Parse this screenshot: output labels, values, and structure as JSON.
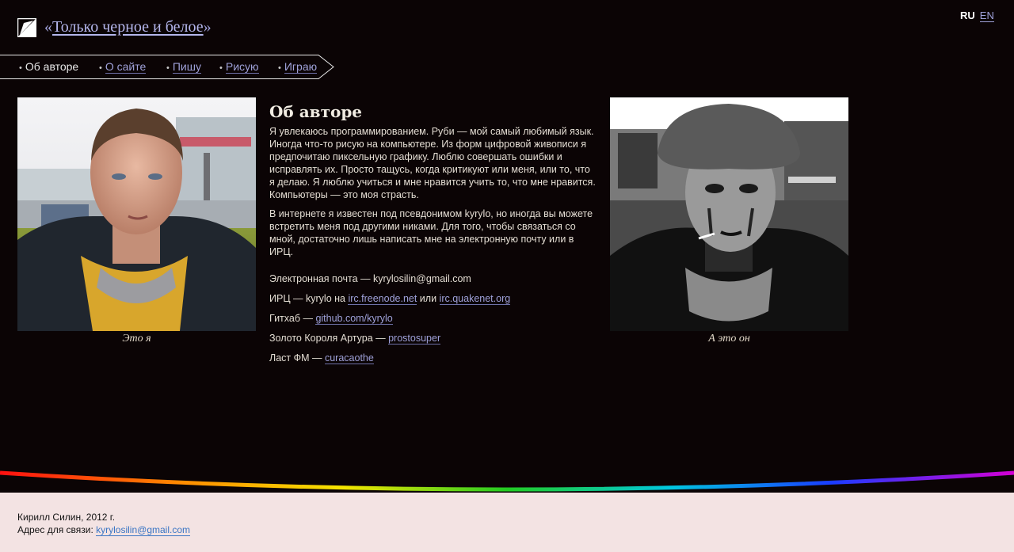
{
  "header": {
    "logo_icon": "black-white-square-logo",
    "quote_open": "«",
    "title": "Только черное и белое",
    "quote_close": "»"
  },
  "lang": {
    "current": "RU",
    "other": "EN"
  },
  "nav": {
    "items": [
      {
        "label": "Об авторе",
        "active": true
      },
      {
        "label": "О сайте",
        "active": false
      },
      {
        "label": "Пишу",
        "active": false
      },
      {
        "label": "Рисую",
        "active": false
      },
      {
        "label": "Играю",
        "active": false
      }
    ]
  },
  "photos": {
    "left_caption": "Это я",
    "right_caption": "А это он"
  },
  "content": {
    "heading": "Об авторе",
    "para1": "Я увлекаюсь программированием. Руби — мой самый любимый язык. Иногда что-то рисую на компьютере. Из форм цифровой живописи я предпочитаю пиксельную графику. Люблю совершать ошибки и исправлять их. Просто тащусь, когда критикуют или меня, или то, что я делаю. Я люблю учиться и мне нравится учить то, что мне нравится. Компьютеры — это моя страсть.",
    "para2": "В интернете я известен под псевдонимом kyrylo, но иногда вы можете встретить меня под другими никами. Для того, чтобы связаться со мной, достаточно лишь написать мне на электронную почту или в ИРЦ.",
    "email_text": "Электронная почта — kyrylosilin@gmail.com",
    "irc_prefix": "ИРЦ — kyrylo на ",
    "irc_link1": "irc.freenode.net",
    "irc_or": " или ",
    "irc_link2": "irc.quakenet.org",
    "github_prefix": "Гитхаб — ",
    "github_link": "github.com/kyrylo",
    "gold_prefix": "Золото Короля Артура — ",
    "gold_link": "prostosuper",
    "lastfm_prefix": "Ласт ФМ — ",
    "lastfm_link": "curacaothe"
  },
  "footer": {
    "copyright": "Кирилл Силин, 2012 г.",
    "contact_label": "Адрес для связи: ",
    "contact_email": "kyrylosilin@gmail.com"
  },
  "colors": {
    "background_dark": "#0b0405",
    "footer_bg": "#f3e3e3",
    "link": "#9fa1d9",
    "footer_link": "#3a75c4"
  }
}
